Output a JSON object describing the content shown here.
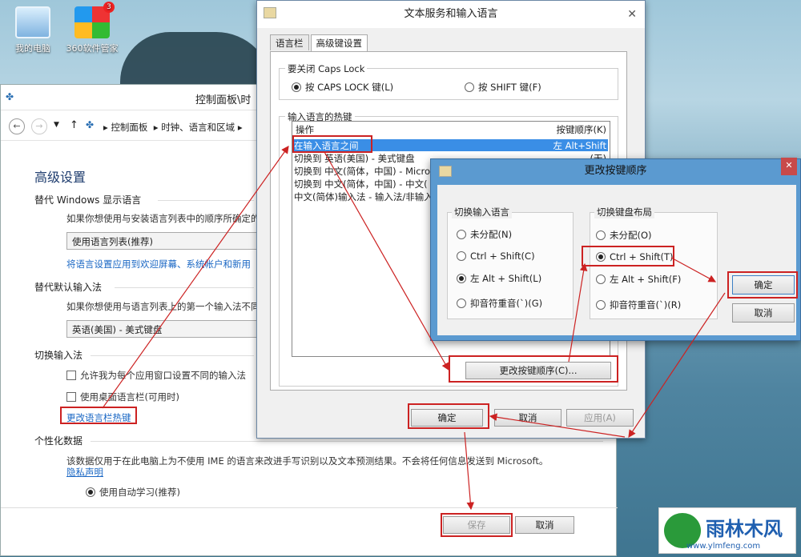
{
  "desktop": {
    "icons": [
      {
        "label": "我的电脑",
        "icon": "computer-icon"
      },
      {
        "label": "360软件管家",
        "icon": "software-manager-icon",
        "badge": "3"
      }
    ]
  },
  "control_panel": {
    "title": "控制面板\\时",
    "breadcrumb": [
      "控制面板",
      "时钟、语言和区域"
    ],
    "heading": "高级设置",
    "override_display_language": {
      "label": "替代 Windows 显示语言",
      "desc": "如果你想使用与安装语言列表中的顺序所确定的",
      "selected": "使用语言列表(推荐)",
      "link": "将语言设置应用到欢迎屏幕、系统帐户和新用"
    },
    "override_input_method": {
      "label": "替代默认输入法",
      "desc": "如果你想使用与语言列表上的第一个输入法不同",
      "selected": "英语(美国) - 美式键盘"
    },
    "switch_input": {
      "label": "切换输入法",
      "option1": "允许我为每个应用窗口设置不同的输入法",
      "option2": "使用桌面语言栏(可用时)",
      "link": "更改语言栏热键"
    },
    "personalization": {
      "label": "个性化数据",
      "desc": "该数据仅用于在此电脑上为不使用 IME 的语言来改进手写识别以及文本预测结果。不会将任何信息发送到 Microsoft。",
      "privacy_link": "隐私声明",
      "option": "使用自动学习(推荐)"
    },
    "save": "保存",
    "cancel": "取消"
  },
  "text_services": {
    "title": "文本服务和输入语言",
    "tabs": [
      "语言栏",
      "高级键设置"
    ],
    "active_tab": 1,
    "caps_group": "要关闭 Caps Lock",
    "caps_options": [
      "按 CAPS LOCK 键(L)",
      "按 SHIFT 键(F)"
    ],
    "hotkey_group": "输入语言的热键",
    "col_action": "操作",
    "col_sequence": "按键顺序(K)",
    "rows": [
      {
        "action": "在输入语言之间",
        "seq": "左 Alt+Shift"
      },
      {
        "action": "切换到 英语(美国) - 美式键盘",
        "seq": "(无)"
      },
      {
        "action": "切换到 中文(简体，中国) - Micro",
        "seq": ""
      },
      {
        "action": "切换到 中文(简体，中国) - 中文(",
        "seq": ""
      },
      {
        "action": "中文(简体)输入法 - 输入法/非输入",
        "seq": ""
      }
    ],
    "change_seq_button": "更改按键顺序(C)...",
    "ok": "确定",
    "cancel": "取消",
    "apply": "应用(A)"
  },
  "change_key_sequence": {
    "title": "更改按键顺序",
    "lang_group": "切换输入语言",
    "lang_options": [
      "未分配(N)",
      "Ctrl + Shift(C)",
      "左 Alt + Shift(L)",
      "抑音符重音(`)(G)"
    ],
    "lang_selected": 2,
    "layout_group": "切换键盘布局",
    "layout_options": [
      "未分配(O)",
      "Ctrl + Shift(T)",
      "左 Alt + Shift(F)",
      "抑音符重音(`)(R)"
    ],
    "layout_selected": 1,
    "ok": "确定",
    "cancel": "取消"
  },
  "watermark": {
    "brand": "雨林木风",
    "url": "www.ylmfeng.com"
  },
  "colors": {
    "highlight_box": "#cc2222",
    "selection": "#3a8ee6",
    "link": "#1a67c4",
    "dialog_frame": "#5b9ad0"
  }
}
